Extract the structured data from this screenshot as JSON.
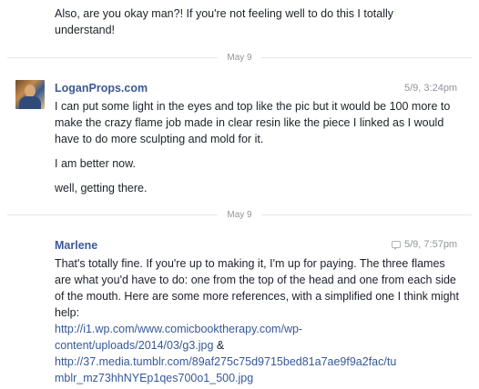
{
  "thread": {
    "previous_message": "Also, are you okay man?! If you're not feeling well to do this I totally understand!",
    "divider_1": "May 9",
    "divider_2": "May 9",
    "logan": {
      "name": "LoganProps.com",
      "timestamp": "5/9, 3:24pm",
      "messages": [
        "I can put some light in the eyes and top like the pic but it would be 100 more to make the crazy flame job made in clear resin like the piece I linked as I would have to do more sculpting and mold for it.",
        "I am better now.",
        "well, getting there."
      ]
    },
    "marlene": {
      "name": "Marlene",
      "timestamp": "5/9, 7:57pm",
      "message_text": "That's totally fine. If you're up to making it, I'm up for paying. The three flames are what you'd have to do: one from the top of the head and one from each side of the mouth. Here are some more references, with a simplified one I think might help:",
      "link_1_line_1": "http://i1.wp.com/www.comicbooktherapy.com/wp-",
      "link_1_line_2": "content/uploads/2014/03/g3.jpg",
      "link_separator": " &",
      "link_2_line_1": "http://37.media.tumblr.com/89af275c75d9715bed81a7ae9f9a2fac/tu",
      "link_2_line_2": "mblr_mz73hhNYEp1qes700o1_500.jpg"
    }
  }
}
